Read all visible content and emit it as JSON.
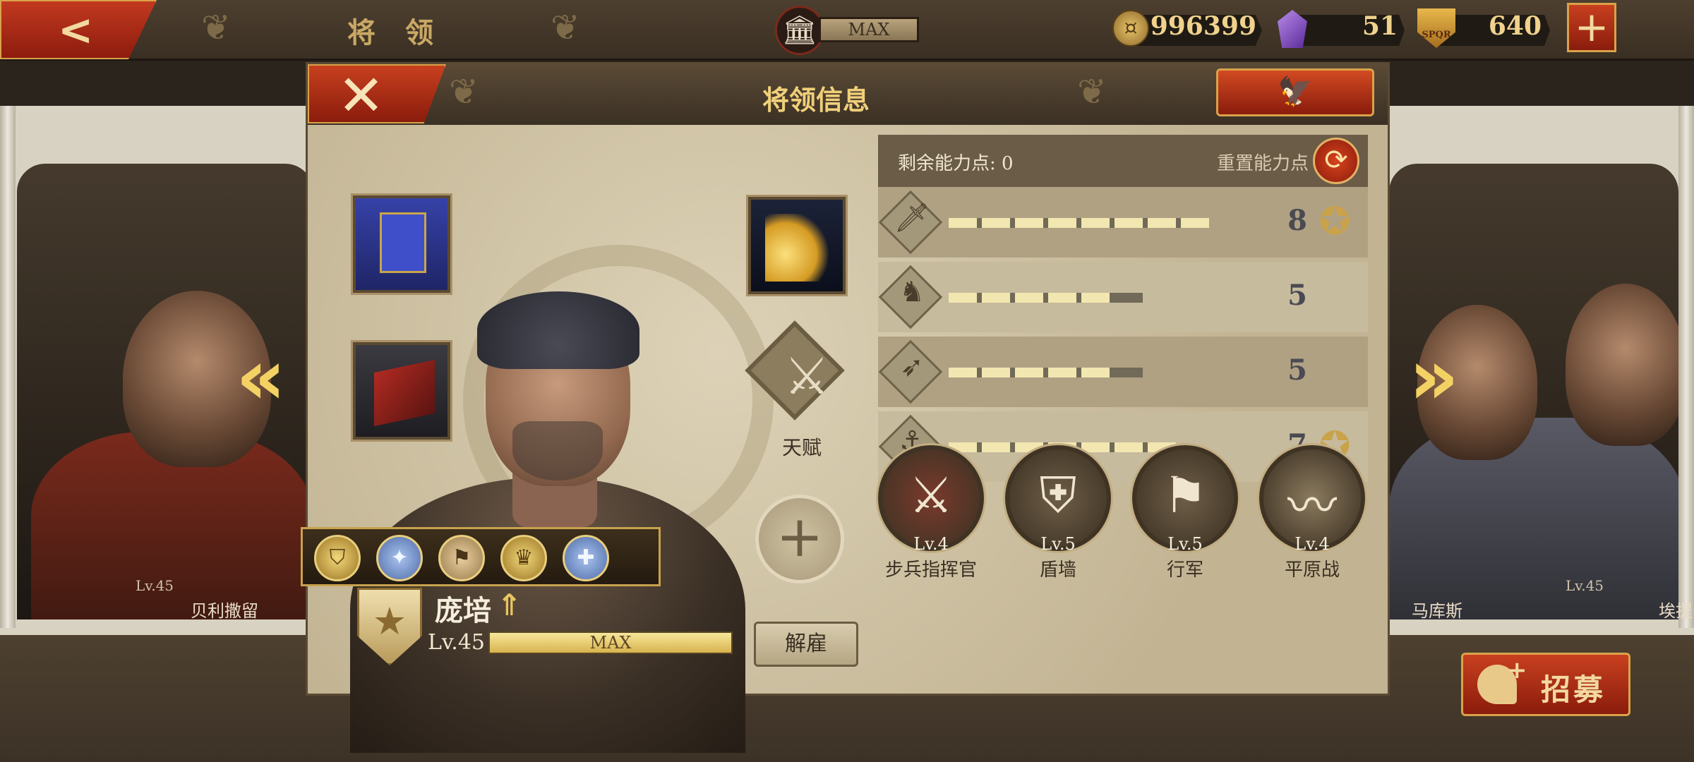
{
  "topbar": {
    "back_icon": "back-arrow-icon",
    "title": "将 领",
    "temple_icon": "temple-icon",
    "temple_status": "MAX",
    "gold": "996399",
    "gems": "51",
    "spqr_tokens": "640",
    "spqr_label": "SPQR",
    "plus_label": "+"
  },
  "side_left": {
    "name": "贝利撒留",
    "level": "Lv.45"
  },
  "side_right_1": {
    "name": "马库斯"
  },
  "side_right_2": {
    "name": "埃提",
    "level": "Lv.45"
  },
  "recruit": {
    "label": "招募"
  },
  "panel": {
    "title": "将领信息",
    "close_label": "✕",
    "eagle_label": "🦅",
    "talent_label": "天赋",
    "add_label": "+",
    "hero": {
      "name": "庞培",
      "level": "Lv.45",
      "xp_status": "MAX",
      "dismiss_label": "解雇"
    },
    "points_label": "剩余能力点: 0",
    "reset_label": "重置能力点",
    "stats": [
      {
        "icon": "sword-icon",
        "glyph": "🗡",
        "value": "8",
        "filled": 8,
        "max": 8,
        "star": true
      },
      {
        "icon": "horse-icon",
        "glyph": "♞",
        "value": "5",
        "filled": 5,
        "max": 6,
        "star": false
      },
      {
        "icon": "bow-icon",
        "glyph": "➶",
        "value": "5",
        "filled": 5,
        "max": 6,
        "star": false
      },
      {
        "icon": "anchor-icon",
        "glyph": "⚓",
        "value": "7",
        "filled": 7,
        "max": 7,
        "star": true
      }
    ],
    "skills": [
      {
        "level": "Lv.4",
        "name": "步兵指挥官",
        "icon": "crossed-swords-icon",
        "glyph": "⚔",
        "color": "#7a3a2c"
      },
      {
        "level": "Lv.5",
        "name": "盾墙",
        "icon": "shield-wall-icon",
        "glyph": "⛨",
        "color": "#6e5e48"
      },
      {
        "level": "Lv.5",
        "name": "行军",
        "icon": "marching-soldiers-icon",
        "glyph": "⚑",
        "color": "#6e5e48"
      },
      {
        "level": "Lv.4",
        "name": "平原战",
        "icon": "plains-icon",
        "glyph": "〰",
        "color": "#8a7a5e"
      }
    ],
    "medals": [
      "shield-medal-icon",
      "eagle-medal-icon",
      "banner-medal-icon",
      "lion-medal-icon",
      "cross-medal-icon"
    ]
  }
}
